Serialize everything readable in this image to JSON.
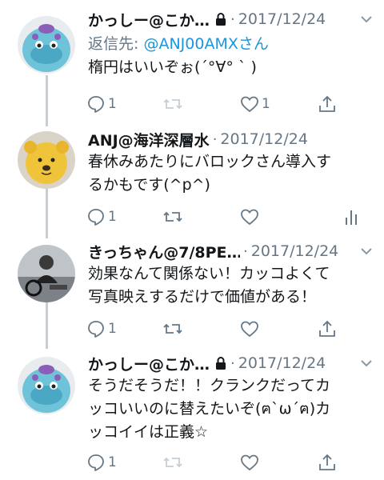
{
  "tweets": [
    {
      "author": "かっしー@こか…",
      "locked": true,
      "date": "2017/12/24",
      "reply_label": "返信先: ",
      "reply_handle": "@ANJ00AMXさん",
      "text": "楕円はいいぞぉ(´°∀° ` )",
      "reply_count": "1",
      "like_count": "1",
      "trailing_action": "share"
    },
    {
      "author": "ANJ@海洋深層水",
      "locked": false,
      "date": "2017/12/24",
      "text_lines": [
        "春休みあたりにバロックさん導入す",
        "るかもです(^p^)"
      ],
      "reply_count": "1",
      "like_count": "",
      "trailing_action": "analytics"
    },
    {
      "author": "きっちゃん@7/8PE…",
      "locked": false,
      "date": "2017/12/24",
      "text_lines": [
        "効果なんて関係ない！カッコよくて",
        "写真映えするだけで価値がある！"
      ],
      "reply_count": "1",
      "like_count": "",
      "trailing_action": "share"
    },
    {
      "author": "かっしー@こか…",
      "locked": true,
      "date": "2017/12/24",
      "text_lines": [
        "そうだそうだ！！クランクだってカ",
        "ッコいいのに替えたいぞ(ฅ`ω´ฅ)カ",
        "ッコイイは正義☆"
      ],
      "reply_count": "1",
      "like_count": "",
      "trailing_action": "share"
    }
  ],
  "separator": "·",
  "icons": {
    "reply": "reply-icon",
    "retweet": "retweet-icon",
    "like": "heart-icon",
    "share": "share-icon",
    "analytics": "analytics-icon",
    "lock": "lock-icon",
    "caret": "chevron-down-icon"
  },
  "colors": {
    "text": "#14171a",
    "secondary": "#657786",
    "link": "#1b95e0",
    "thread_line": "#c4ced6",
    "retweet_disabled": "#c4ced6"
  }
}
